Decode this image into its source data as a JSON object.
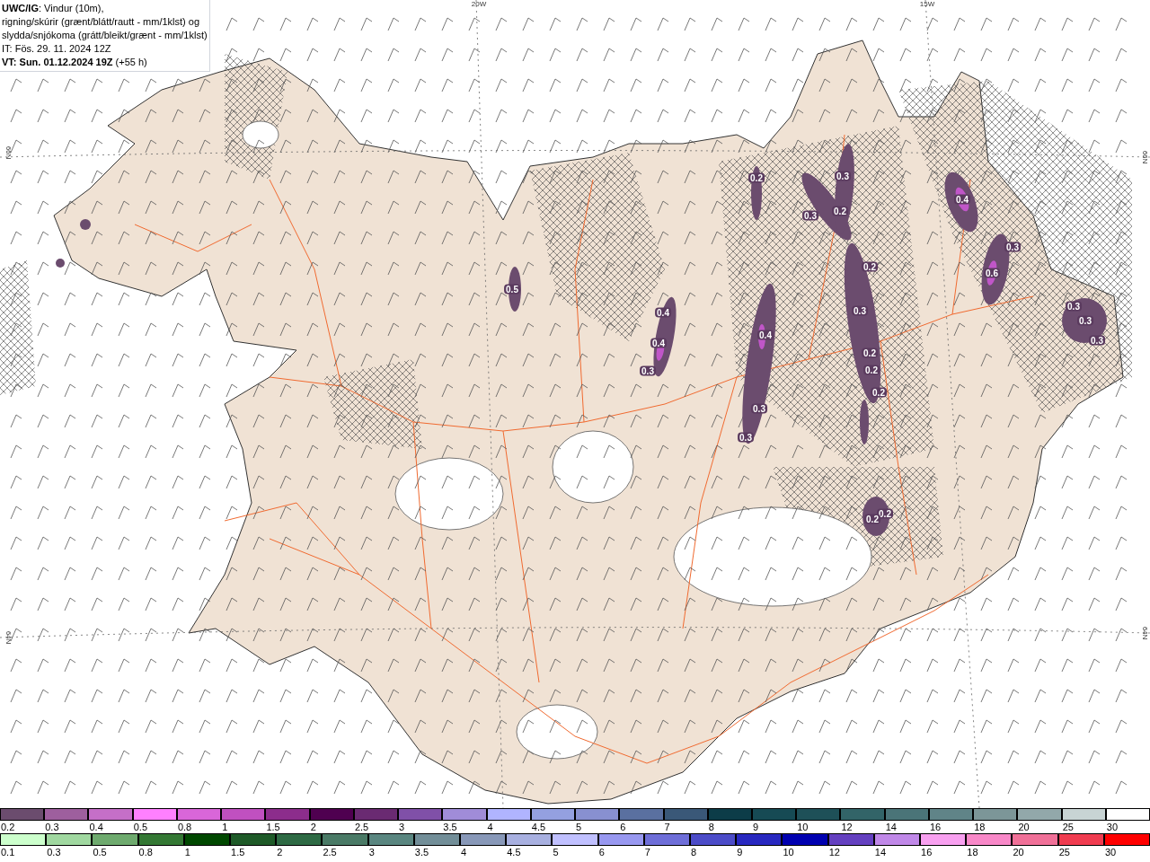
{
  "header": {
    "lines": [
      "**UWC/IG**: Vindur (10m),",
      "rigning/skúrir (grænt/blátt/rautt - mm/1klst) og",
      "slydda/snjókoma (grátt/bleikt/grænt - mm/1klst)",
      "IT: Fös. 29. 11. 2024 12Z",
      "**VT: Sun. 01.12.2024 19Z** (+55 h)"
    ]
  },
  "map": {
    "top_labels": [
      "20W",
      "15W"
    ],
    "left_labels": [
      "66N",
      "64N"
    ],
    "right_labels": [
      "66N",
      "64N"
    ],
    "precipitation_labels": [
      {
        "label": "0.5"
      },
      {
        "label": "0.4"
      },
      {
        "label": "0.4"
      },
      {
        "label": "0.3"
      },
      {
        "label": "0.4"
      },
      {
        "label": "0.3"
      },
      {
        "label": "0.3"
      },
      {
        "label": "0.2"
      },
      {
        "label": "0.3"
      },
      {
        "label": "0.2"
      },
      {
        "label": "0.3"
      },
      {
        "label": "0.2"
      },
      {
        "label": "0.3"
      },
      {
        "label": "0.2"
      },
      {
        "label": "0.2"
      },
      {
        "label": "0.2"
      },
      {
        "label": "0.4"
      },
      {
        "label": "0.6"
      },
      {
        "label": "0.3"
      },
      {
        "label": "0.3"
      },
      {
        "label": "0.3"
      },
      {
        "label": "0.3"
      },
      {
        "label": "0.2"
      },
      {
        "label": "0.2"
      }
    ]
  },
  "legend": {
    "snow_scale": [
      {
        "label": "0.2",
        "color": "#6b4c6e"
      },
      {
        "label": "0.3",
        "color": "#9e5f9e"
      },
      {
        "label": "0.4",
        "color": "#c56fc8"
      },
      {
        "label": "0.5",
        "color": "#ff80ff"
      },
      {
        "label": "0.8",
        "color": "#d966d9"
      },
      {
        "label": "1",
        "color": "#c050c0"
      },
      {
        "label": "1.5",
        "color": "#8c2d8c"
      },
      {
        "label": "2",
        "color": "#4f0050"
      },
      {
        "label": "2.5",
        "color": "#6a2a72"
      },
      {
        "label": "3",
        "color": "#8050a8"
      },
      {
        "label": "3.5",
        "color": "#a08cd8"
      },
      {
        "label": "4",
        "color": "#b0b4ff"
      },
      {
        "label": "4.5",
        "color": "#94a0e0"
      },
      {
        "label": "5",
        "color": "#8890d0"
      },
      {
        "label": "6",
        "color": "#5a70a0"
      },
      {
        "label": "7",
        "color": "#3a5878"
      },
      {
        "label": "8",
        "color": "#0c3c48"
      },
      {
        "label": "9",
        "color": "#164a54"
      },
      {
        "label": "10",
        "color": "#1e5058"
      },
      {
        "label": "12",
        "color": "#326468"
      },
      {
        "label": "14",
        "color": "#4a7478"
      },
      {
        "label": "16",
        "color": "#608488"
      },
      {
        "label": "18",
        "color": "#7c9698"
      },
      {
        "label": "20",
        "color": "#92a8aa"
      },
      {
        "label": "25",
        "color": "#c8d4d4"
      },
      {
        "label": "30",
        "color": "#ffffff"
      }
    ],
    "rain_scale": [
      {
        "label": "0.1",
        "color": "#ccffcc"
      },
      {
        "label": "0.3",
        "color": "#a0d8a0"
      },
      {
        "label": "0.5",
        "color": "#6eaa6e"
      },
      {
        "label": "0.8",
        "color": "#347834"
      },
      {
        "label": "1",
        "color": "#004800"
      },
      {
        "label": "1.5",
        "color": "#1e5a28"
      },
      {
        "label": "2",
        "color": "#2e6a44"
      },
      {
        "label": "2.5",
        "color": "#4a7a66"
      },
      {
        "label": "3",
        "color": "#5a8680"
      },
      {
        "label": "3.5",
        "color": "#728e98"
      },
      {
        "label": "4",
        "color": "#8898b8"
      },
      {
        "label": "4.5",
        "color": "#a8b0e0"
      },
      {
        "label": "5",
        "color": "#c0c0ff"
      },
      {
        "label": "6",
        "color": "#9898f0"
      },
      {
        "label": "7",
        "color": "#6e6ed8"
      },
      {
        "label": "8",
        "color": "#4c4cc8"
      },
      {
        "label": "9",
        "color": "#2828c0"
      },
      {
        "label": "10",
        "color": "#0000b0"
      },
      {
        "label": "12",
        "color": "#6440c0"
      },
      {
        "label": "14",
        "color": "#c088e8"
      },
      {
        "label": "16",
        "color": "#f8a0f0"
      },
      {
        "label": "18",
        "color": "#f888c8"
      },
      {
        "label": "20",
        "color": "#f07098"
      },
      {
        "label": "25",
        "color": "#f03c50"
      },
      {
        "label": "30",
        "color": "#ff0000"
      }
    ]
  }
}
